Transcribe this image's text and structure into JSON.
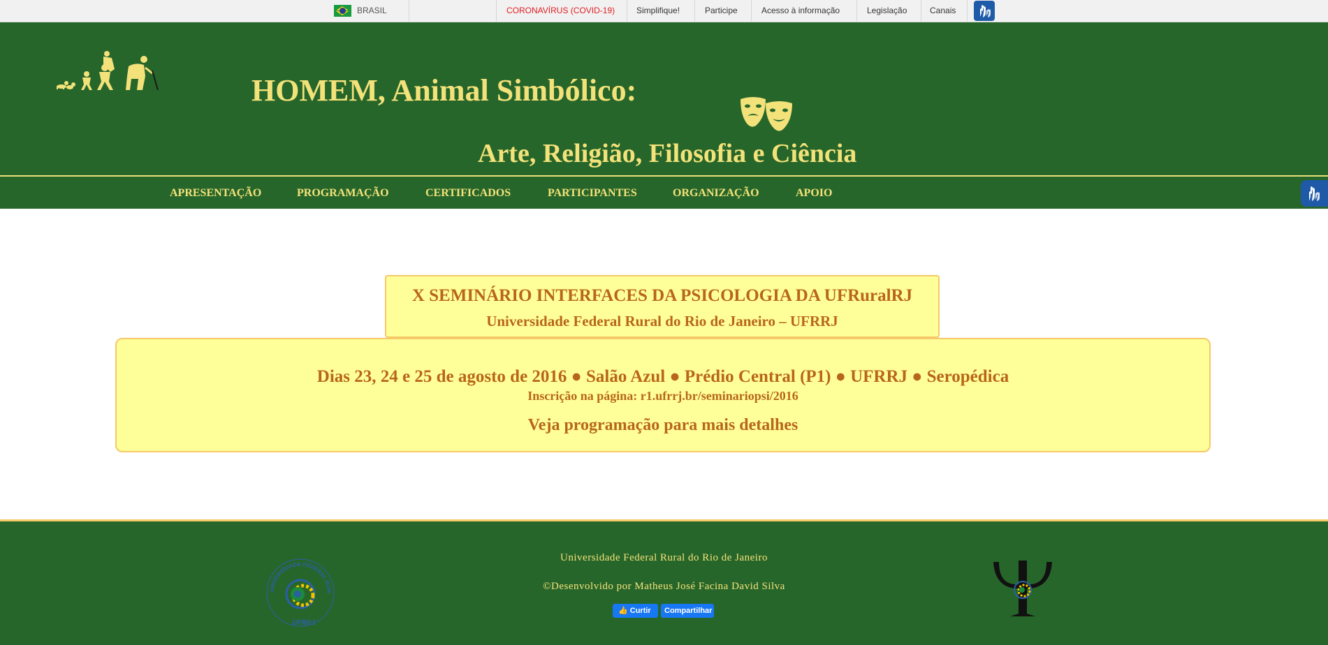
{
  "gov_bar": {
    "country": "BRASIL",
    "links": [
      "CORONAVÍRUS (COVID-19)",
      "Simplifique!",
      "Participe",
      "Acesso à informação",
      "Legislação",
      "Canais"
    ],
    "covid_color": "#e11d21"
  },
  "header": {
    "title_line1": "HOMEM, Animal Simbólico:",
    "title_line2": "Arte, Religião, Filosofia e Ciência",
    "bg_color": "#27662a",
    "text_color": "#f3e27a"
  },
  "nav": {
    "items": [
      "APRESENTAÇÃO",
      "PROGRAMAÇÃO",
      "CERTIFICADOS",
      "PARTICIPANTES",
      "ORGANIZAÇÃO",
      "APOIO"
    ]
  },
  "main": {
    "event_title": "X SEMINÁRIO INTERFACES DA PSICOLOGIA DA UFRuralRJ",
    "university": "Universidade Federal Rural do Rio de Janeiro – UFRRJ",
    "dates_location": "Dias 23, 24 e 25 de agosto de 2016 ● Salão Azul ● Prédio Central (P1) ● UFRRJ ● Seropédica",
    "registration": "Inscrição na página: r1.ufrrj.br/seminariopsi/2016",
    "see_program": "Veja programação para mais detalhes",
    "box_bg": "#ffff99",
    "box_text_color": "#b8661a"
  },
  "footer": {
    "university": "Universidade Federal Rural do Rio de Janeiro",
    "credit": "©Desenvolvido por Matheus José Facina David Silva",
    "like_label": "Curtir",
    "share_label": "Compartilhar",
    "seal_text": "UNIVERSIDADE FEDERAL RURAL DO RIO DE JANEIRO",
    "seal_label": "UFRRJ"
  }
}
